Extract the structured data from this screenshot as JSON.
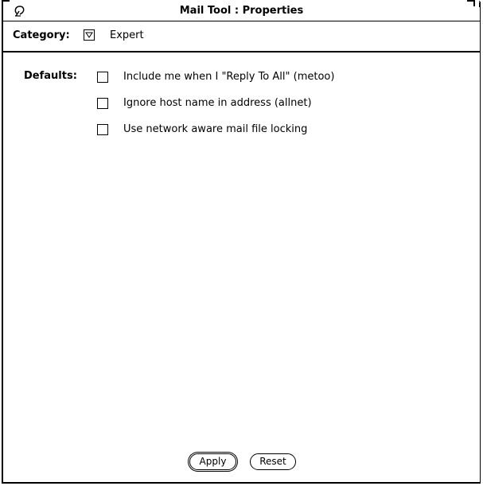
{
  "window": {
    "title": "Mail Tool : Properties"
  },
  "category": {
    "label": "Category:",
    "selected": "Expert",
    "menu_icon": "triangle-down-icon"
  },
  "defaults": {
    "label": "Defaults:",
    "options": [
      {
        "label": "Include me when I \"Reply To All\" (metoo)",
        "checked": false
      },
      {
        "label": "Ignore host name in address (allnet)",
        "checked": false
      },
      {
        "label": "Use network aware mail file locking",
        "checked": false
      }
    ]
  },
  "buttons": {
    "apply_label": "Apply",
    "reset_label": "Reset"
  }
}
